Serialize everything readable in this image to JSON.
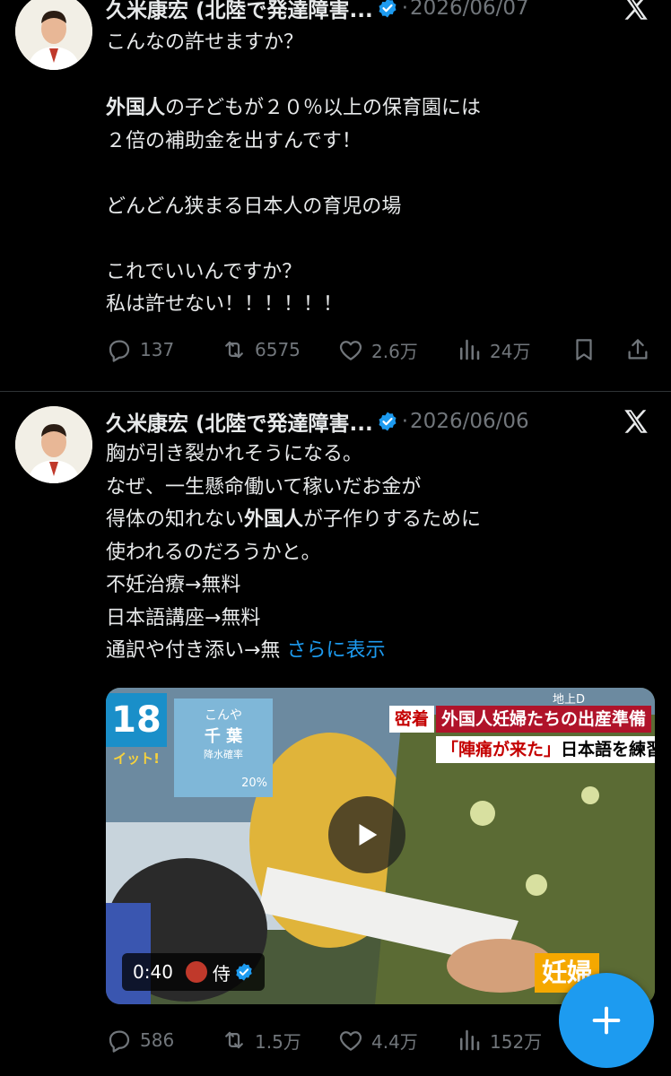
{
  "tweets": [
    {
      "author": "久米康宏 (北陸で発達障害...",
      "date_sep": "·",
      "date": "2026/06/07",
      "lines": [
        "こんなの許せますか？",
        "",
        [
          "外国人",
          "の子どもが２０％以上の保育園には"
        ],
        "２倍の補助金を出すんです！",
        "",
        "どんどん狭まる日本人の育児の場",
        "",
        "これでいいんですか？",
        "私は許せない！！！！！！"
      ],
      "replies": "137",
      "reposts": "6575",
      "likes": "2.6万",
      "views": "24万"
    },
    {
      "author": "久米康宏 (北陸で発達障害...",
      "date_sep": "·",
      "date": "2026/06/06",
      "lines": [
        "胸が引き裂かれそうになる。",
        "なぜ、一生懸命働いて稼いだお金が",
        [
          "得体の知れない",
          "外国人",
          "が子作りするために"
        ],
        "使われるのだろうかと。",
        "不妊治療→無料",
        "日本語講座→無料",
        [
          "通訳や付き添い→無 ",
          "さらに表示"
        ]
      ],
      "media": {
        "duration": "0:40",
        "channel": "侍",
        "tv_number": "18",
        "tv_sub": "イット!",
        "weather_city": "こんや",
        "weather_pref": "千 葉",
        "weather_label": "降水確率",
        "weather_pct": "20%",
        "caption_tag": "密着",
        "caption_top": "外国人妊婦たちの出産準備",
        "caption_sub_red": "「陣痛が来た」",
        "caption_sub": "日本語を練習",
        "corner_label": "妊婦",
        "channel_tag": "地上D"
      },
      "replies": "586",
      "reposts": "1.5万",
      "likes": "4.4万",
      "views": "152万"
    }
  ],
  "colors": {
    "background": "#000000",
    "text": "#e7e9ea",
    "muted": "#71767b",
    "accent": "#1d9bf0"
  },
  "icons": [
    "x-logo-icon",
    "verified-icon",
    "reply-icon",
    "repost-icon",
    "like-icon",
    "views-icon",
    "bookmark-icon",
    "share-icon",
    "play-icon",
    "compose-icon"
  ]
}
